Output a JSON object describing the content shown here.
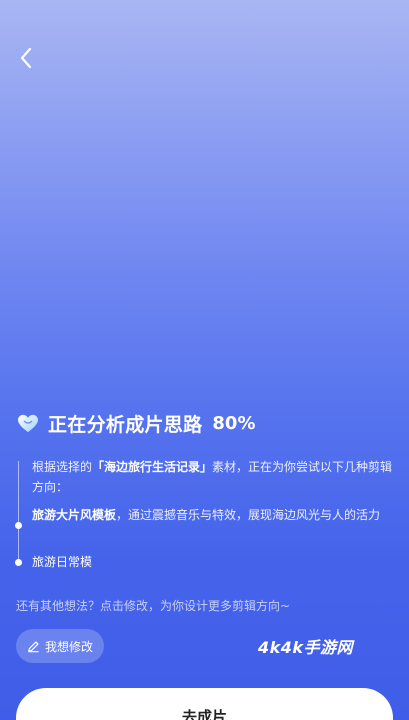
{
  "colors": {
    "background_top": "#a9b6f3",
    "background_bottom": "#3f5de8",
    "accent_white": "#ffffff",
    "cta_text": "#222222"
  },
  "icons": {
    "back": "chevron-left-icon",
    "status": "heart-icon",
    "edit": "pencil-icon"
  },
  "header": {
    "title": "正在分析成片思路",
    "progress_text": "80%",
    "progress": 80
  },
  "timeline": {
    "desc_prefix": "根据选择的",
    "material_name": "「海边旅行生活记录」",
    "desc_suffix": "素材，正在为你尝试以下几种剪辑方向：",
    "options": [
      {
        "title": "旅游大片风模板",
        "detail": "，通过震撼音乐与特效，展现海边风光与人的活力"
      },
      {
        "title": "旅游日常模"
      }
    ]
  },
  "hint": "还有其他想法？点击修改，为你设计更多剪辑方向~",
  "edit_button": {
    "label": "我想修改"
  },
  "watermark": "4k4k手游网",
  "cta": {
    "label": "去成片"
  }
}
